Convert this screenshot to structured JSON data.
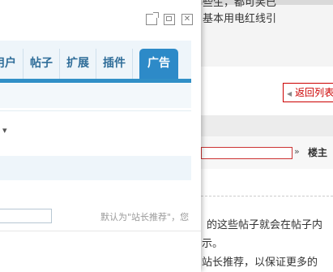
{
  "background": {
    "line1": "些生，都可笑已",
    "line2": "基本用电红线引",
    "back_button": "返回列表",
    "owner_label": "楼主",
    "arrow": "»",
    "para1": "的这些帖子就会在帖子内",
    "para2": "示。",
    "para3": "站长推荐，以保证更多的"
  },
  "dialog": {
    "window_icons": [
      "popout-icon",
      "maximize-icon",
      "close-icon"
    ],
    "tabs": [
      {
        "label": "用户",
        "active": false
      },
      {
        "label": "帖子",
        "active": false
      },
      {
        "label": "扩展",
        "active": false
      },
      {
        "label": "插件",
        "active": false
      },
      {
        "label": "广告",
        "active": true
      }
    ],
    "select_arrow": "▾",
    "input_value": "",
    "hint": "默认为\"站长推荐\"，您"
  },
  "colors": {
    "accent": "#2d8ac8",
    "tab_text": "#2f6d99",
    "alert_red": "#cc0000"
  }
}
